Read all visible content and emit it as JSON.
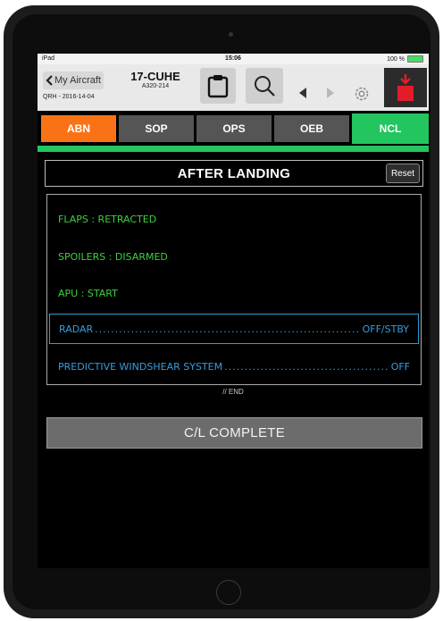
{
  "statusbar": {
    "device": "iPad",
    "time": "15:06",
    "battery": "100 %"
  },
  "toolbar": {
    "back_label": "My Aircraft",
    "qrh": "QRH - 2016-14-04",
    "aircraft_reg": "17-CUHE",
    "aircraft_type": "A320-214",
    "icons": [
      "clipboard-icon",
      "search-icon",
      "arrow-left-icon",
      "arrow-right-icon",
      "gear-icon",
      "exit-icon"
    ]
  },
  "tabs": [
    {
      "label": "ABN",
      "color": "#f97316",
      "active": false
    },
    {
      "label": "SOP",
      "color": "#555555",
      "active": false
    },
    {
      "label": "OPS",
      "color": "#555555",
      "active": false
    },
    {
      "label": "OEB",
      "color": "#555555",
      "active": false
    },
    {
      "label": "NCL",
      "color": "#22c55e",
      "active": true
    }
  ],
  "checklist": {
    "title": "AFTER LANDING",
    "reset_label": "Reset",
    "items": [
      {
        "text": "FLAPS : RETRACTED",
        "color": "green"
      },
      {
        "text": "SPOILERS : DISARMED",
        "color": "green"
      },
      {
        "text": "APU : START",
        "color": "green"
      },
      {
        "label": "RADAR",
        "value": "OFF/STBY",
        "color": "blue",
        "selected": true
      },
      {
        "label": "PREDICTIVE WINDSHEAR SYSTEM",
        "value": "OFF",
        "color": "blue",
        "selected": false
      }
    ],
    "end_label": "// END",
    "complete_label": "C/L COMPLETE"
  },
  "colors": {
    "green_text": "#3fcf3f",
    "blue_text": "#3a9be0",
    "accent_blue": "#2a9fd6",
    "exit_red": "#e11d2a"
  }
}
